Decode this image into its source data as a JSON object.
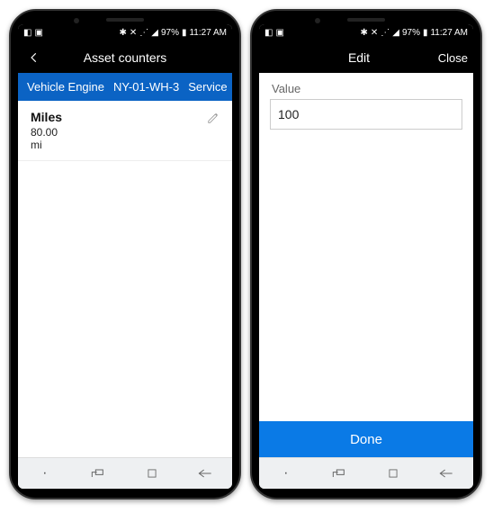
{
  "statusbar": {
    "battery_pct": "97%",
    "time": "11:27 AM"
  },
  "phoneA": {
    "appbar": {
      "title": "Asset counters"
    },
    "breadcrumb": {
      "item1": "Vehicle Engine",
      "item2": "NY-01-WH-3",
      "item3": "Service"
    },
    "counter": {
      "name": "Miles",
      "value": "80.00",
      "unit": "mi"
    }
  },
  "phoneB": {
    "appbar": {
      "title": "Edit",
      "close": "Close"
    },
    "field": {
      "label": "Value",
      "value": "100"
    },
    "done_label": "Done"
  }
}
